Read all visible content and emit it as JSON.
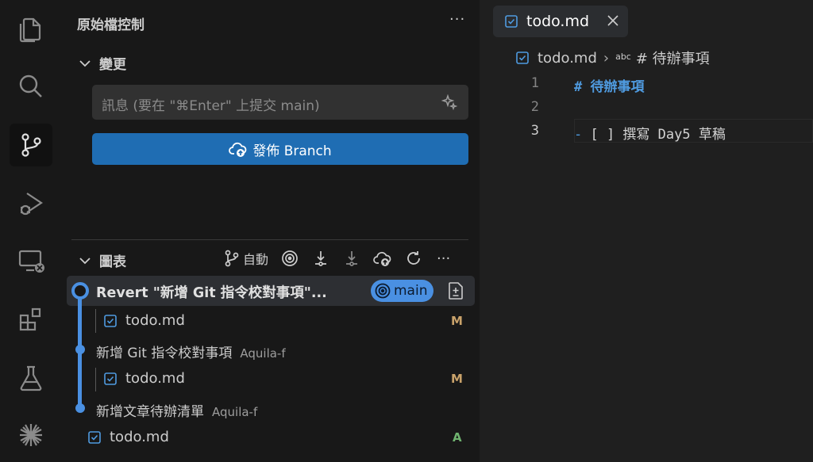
{
  "sidebar": {
    "title": "原始檔控制",
    "changes_section": "變更",
    "commit_placeholder": "訊息 (要在 \"⌘Enter\" 上提交 main)",
    "publish_label": "發佈 Branch",
    "graph_section": "圖表",
    "graph_auto_label": "自動"
  },
  "graph": {
    "commits": [
      {
        "message": "Revert \"新增 Git 指令校對事項\"...",
        "author": "",
        "branch": "main",
        "file": "todo.md",
        "status": "M"
      },
      {
        "message": "新增 Git 指令校對事項",
        "author": "Aquila-f",
        "file": "todo.md",
        "status": "M"
      },
      {
        "message": "新增文章待辦清單",
        "author": "Aquila-f",
        "file": "todo.md",
        "status": "A"
      }
    ]
  },
  "editor": {
    "tab_label": "todo.md",
    "breadcrumb_file": "todo.md",
    "breadcrumb_abc": "abc",
    "breadcrumb_symbol": "# 待辦事項",
    "lines": [
      {
        "num": "1",
        "text": "# 待辦事項"
      },
      {
        "num": "2",
        "text": ""
      },
      {
        "num": "3",
        "dash": "-",
        "text": " [ ] 撰寫 Day5 草稿"
      }
    ]
  },
  "colors": {
    "accent": "#4a90e2",
    "button": "#1f6db3",
    "modified": "#c9a26a",
    "added": "#6fb36f",
    "heading": "#4f9be0"
  }
}
